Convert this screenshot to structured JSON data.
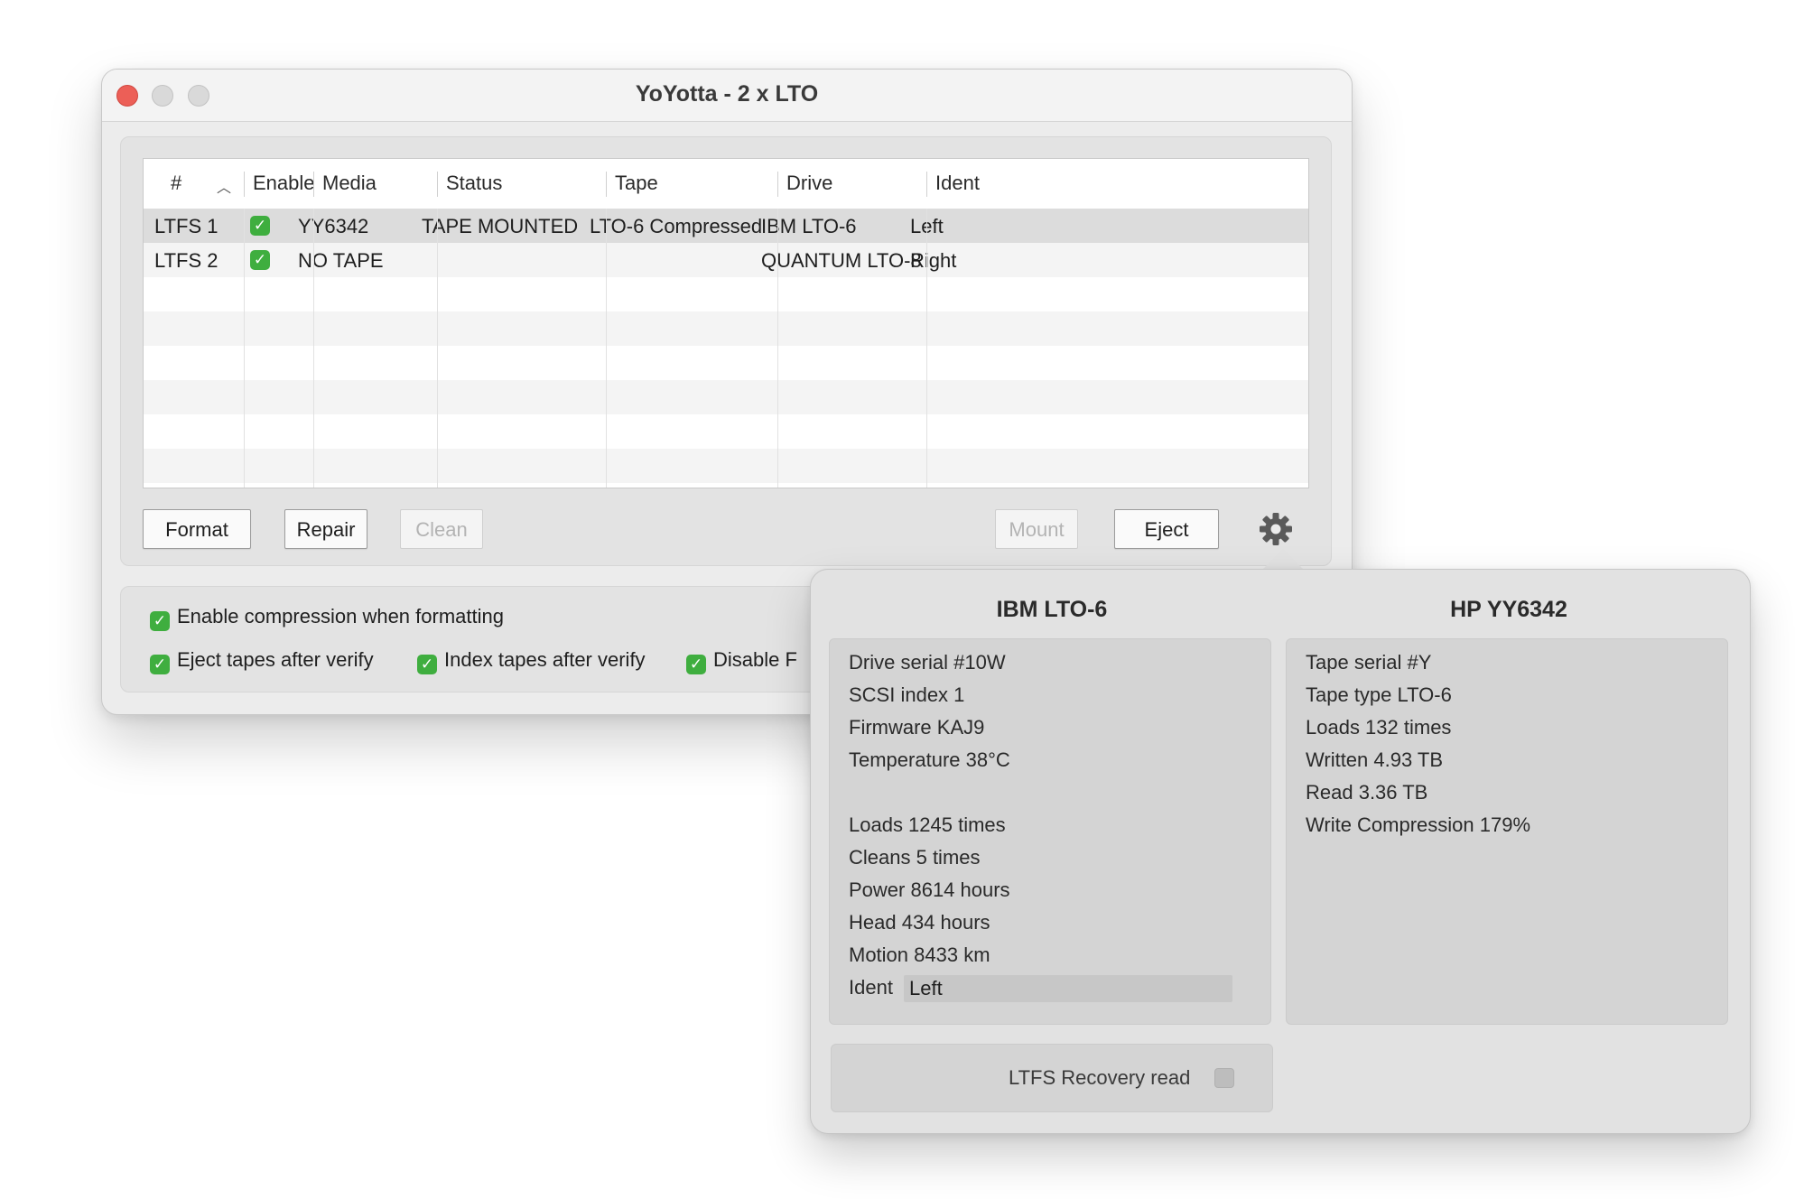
{
  "window": {
    "title": "YoYotta - 2 x LTO"
  },
  "table": {
    "columns": [
      "#",
      "Enable",
      "Media",
      "Status",
      "Tape",
      "Drive",
      "Ident"
    ],
    "rows": [
      {
        "id": "LTFS 1",
        "enabled": true,
        "media": "YY6342",
        "status": "TAPE MOUNTED",
        "tape": "LTO-6 Compressed",
        "drive": "IBM LTO-6",
        "ident": "Left",
        "selected": true
      },
      {
        "id": "LTFS 2",
        "enabled": true,
        "media": "NO TAPE",
        "status": "",
        "tape": "",
        "drive": "QUANTUM LTO-8",
        "ident": "Right",
        "selected": false
      }
    ]
  },
  "buttons": {
    "format": "Format",
    "repair": "Repair",
    "clean": "Clean",
    "mount": "Mount",
    "eject": "Eject"
  },
  "options": {
    "enable_compression": "Enable compression when formatting",
    "eject_after_verify": "Eject tapes after verify",
    "index_after_verify": "Index tapes after verify",
    "disable_partial": "Disable F"
  },
  "popover": {
    "drive": {
      "heading": "IBM LTO-6",
      "lines": [
        "Drive serial #10W",
        "SCSI index 1",
        "Firmware KAJ9",
        "Temperature 38°C",
        "Loads 1245 times",
        "Cleans 5 times",
        "Power 8614 hours",
        "Head 434 hours",
        "Motion 8433 km"
      ],
      "ident_label": "Ident",
      "ident_value": "Left"
    },
    "tape": {
      "heading": "HP YY6342",
      "lines": [
        "Tape serial #Y",
        "Tape type LTO-6",
        "Loads 132 times",
        "Written 4.93 TB",
        "Read 3.36 TB",
        "Write Compression 179%"
      ]
    },
    "recovery_label": "LTFS Recovery read"
  },
  "colors": {
    "accent_green": "#3fae3f",
    "close_red": "#ec5f57"
  },
  "icons": {
    "sort": "chevron-up-icon",
    "settings": "gear-icon",
    "check": "checkmark-icon"
  }
}
